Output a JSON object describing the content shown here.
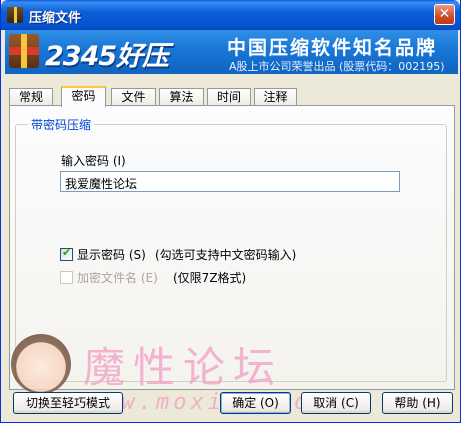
{
  "window": {
    "title": "压缩文件",
    "close_symbol": "✕"
  },
  "banner": {
    "brand": "2345好压",
    "slogan": "中国压缩软件知名品牌",
    "subtitle": "A股上市公司荣誉出品 (股票代码：002195)"
  },
  "tabs": [
    {
      "label": "常规"
    },
    {
      "label": "密码"
    },
    {
      "label": "文件"
    },
    {
      "label": "算法"
    },
    {
      "label": "时间"
    },
    {
      "label": "注释"
    }
  ],
  "active_tab": "密码",
  "password_group": {
    "title": "带密码压缩",
    "input_label": "输入密码 (I)",
    "input_value": "我爱魔性论坛",
    "show_password": {
      "label": "显示密码 (S)",
      "hint": "(勾选可支持中文密码输入)",
      "checked": true
    },
    "encrypt_filenames": {
      "label": "加密文件名 (E)",
      "hint": "(仅限7Z格式)",
      "checked": false,
      "enabled": false
    }
  },
  "watermark": {
    "title": "魔性论坛",
    "url": "www.moxing.com"
  },
  "buttons": {
    "switch_mode": "切换至轻巧模式",
    "ok": "确定 (O)",
    "cancel": "取消 (C)",
    "help": "帮助 (H)"
  },
  "colors": {
    "titlebar": "#0a5fd8",
    "banner": "#1877d6",
    "group_title": "#0046d5",
    "active_tab_accent": "#ffc83c",
    "watermark": "#f3a7c8"
  }
}
